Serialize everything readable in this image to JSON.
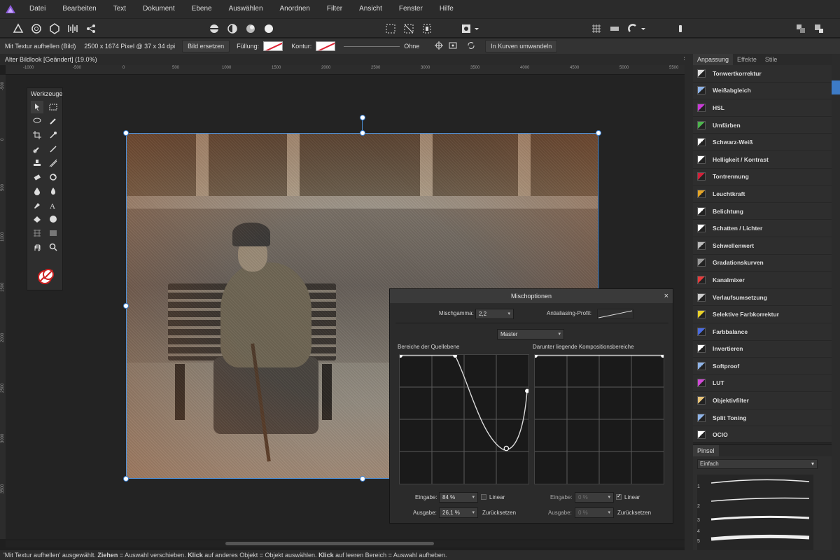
{
  "menu": [
    "Datei",
    "Bearbeiten",
    "Text",
    "Dokument",
    "Ebene",
    "Auswählen",
    "Anordnen",
    "Filter",
    "Ansicht",
    "Fenster",
    "Hilfe"
  ],
  "context": {
    "layer_name": "Mit Textur aufhellen (Bild)",
    "image_info": "2500 x 1674 Pixel @ 37 x 34 dpi",
    "replace_button": "Bild ersetzen",
    "fill_label": "Füllung:",
    "stroke_label": "Kontur:",
    "stroke_value": "Ohne",
    "convert_button": "In Kurven umwandeln"
  },
  "document": {
    "tab_title": "Alter Bildlook [Geändert] (19.0%)",
    "close": "×"
  },
  "ruler": {
    "h_labels": [
      "-1000",
      "-500",
      "0",
      "500",
      "1000",
      "1500",
      "2000",
      "2500",
      "3000",
      "3500",
      "4000",
      "4500",
      "5000",
      "5500"
    ],
    "v_labels": [
      "-500",
      "0",
      "500",
      "1000",
      "1500",
      "2000",
      "2500",
      "3000",
      "3500"
    ]
  },
  "tools": {
    "title": "Werkzeuge"
  },
  "blend_dialog": {
    "title": "Mischoptionen",
    "close": "×",
    "gamma_label": "Mischgamma:",
    "gamma_value": "2,2",
    "antialias_label": "Antialiasing-Profil:",
    "channel_value": "Master",
    "source_title": "Bereiche der Quellebene",
    "underlying_title": "Darunter liegende Kompositionsbereiche",
    "left": {
      "input_label": "Eingabe:",
      "input_value": "84 %",
      "output_label": "Ausgabe:",
      "output_value": "26,1 %",
      "linear_label": "Linear",
      "linear_checked": false,
      "reset_label": "Zurücksetzen"
    },
    "right": {
      "input_label": "Eingabe:",
      "input_value": "0 %",
      "output_label": "Ausgabe:",
      "output_value": "0 %",
      "linear_label": "Linear",
      "linear_checked": true,
      "reset_label": "Zurücksetzen"
    }
  },
  "adjustments_panel": {
    "tabs": [
      "Anpassung",
      "Effekte",
      "Stile"
    ],
    "items": [
      {
        "label": "Tonwertkorrektur",
        "icon": "levels-icon",
        "color": "#dddddd"
      },
      {
        "label": "Weißabgleich",
        "icon": "white-balance-icon",
        "color": "#8fb4e8"
      },
      {
        "label": "HSL",
        "icon": "hsl-icon",
        "color": "#c83bd6"
      },
      {
        "label": "Umfärben",
        "icon": "recolor-icon",
        "color": "#4db34d"
      },
      {
        "label": "Schwarz-Weiß",
        "icon": "black-white-icon",
        "color": "#ffffff"
      },
      {
        "label": "Helligkeit / Kontrast",
        "icon": "brightness-contrast-icon",
        "color": "#ffffff"
      },
      {
        "label": "Tontrennung",
        "icon": "posterize-icon",
        "color": "#d0213a"
      },
      {
        "label": "Leuchtkraft",
        "icon": "vibrance-icon",
        "color": "#e3a427"
      },
      {
        "label": "Belichtung",
        "icon": "exposure-icon",
        "color": "#ffffff"
      },
      {
        "label": "Schatten / Lichter",
        "icon": "shadows-highlights-icon",
        "color": "#ffffff"
      },
      {
        "label": "Schwellenwert",
        "icon": "threshold-icon",
        "color": "#bbbbbb"
      },
      {
        "label": "Gradationskurven",
        "icon": "curves-icon",
        "color": "#999999"
      },
      {
        "label": "Kanalmixer",
        "icon": "channel-mixer-icon",
        "color": "#e83b3b"
      },
      {
        "label": "Verlaufsumsetzung",
        "icon": "gradient-map-icon",
        "color": "#cccccc"
      },
      {
        "label": "Selektive Farbkorrektur",
        "icon": "selective-color-icon",
        "color": "#e8d02b"
      },
      {
        "label": "Farbbalance",
        "icon": "color-balance-icon",
        "color": "#4a6be0"
      },
      {
        "label": "Invertieren",
        "icon": "invert-icon",
        "color": "#ffffff"
      },
      {
        "label": "Softproof",
        "icon": "soft-proof-icon",
        "color": "#8fb4e8"
      },
      {
        "label": "LUT",
        "icon": "lut-icon",
        "color": "#d04ad6"
      },
      {
        "label": "Objektivfilter",
        "icon": "lens-filter-icon",
        "color": "#e8c47a"
      },
      {
        "label": "Split Toning",
        "icon": "split-toning-icon",
        "color": "#8fb4e8"
      },
      {
        "label": "OCIO",
        "icon": "ocio-icon",
        "color": "#ffffff"
      }
    ]
  },
  "brush_panel": {
    "tab": "Pinsel",
    "category": "Einfach",
    "numbers": [
      "1",
      "2",
      "3",
      "4",
      "5"
    ]
  },
  "statusbar": {
    "part1": "'Mit Textur aufhellen' ausgewählt. ",
    "bold1": "Ziehen",
    "part2": " = Auswahl verschieben. ",
    "bold2": "Klick",
    "part3": " auf anderes Objekt = Objekt auswählen. ",
    "bold3": "Klick",
    "part4": " auf leeren Bereich = Auswahl aufheben."
  }
}
